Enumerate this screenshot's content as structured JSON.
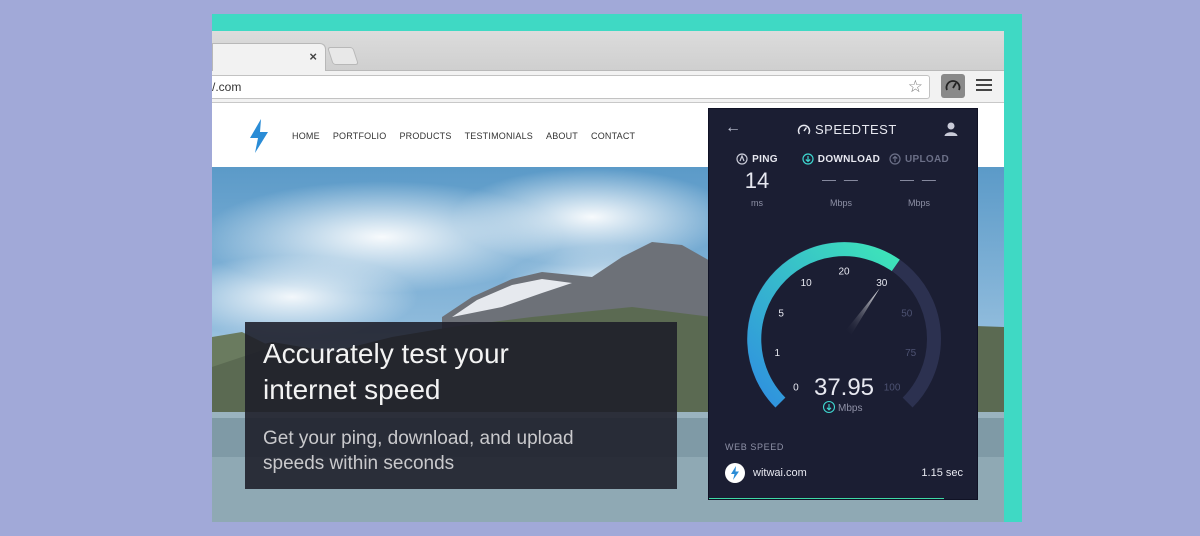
{
  "browser": {
    "tab_close": "×",
    "url_fragment": "/.com"
  },
  "site": {
    "nav": [
      "HOME",
      "PORTFOLIO",
      "PRODUCTS",
      "TESTIMONIALS",
      "ABOUT",
      "CONTACT"
    ],
    "hero_title_line1": "Accurately test your",
    "hero_title_line2": "internet speed",
    "hero_sub_line1": "Get your ping, download, and upload",
    "hero_sub_line2": "speeds within seconds"
  },
  "speedtest": {
    "back_icon": "←",
    "brand": "SPEEDTEST",
    "metrics": {
      "ping_label": "PING",
      "ping_value": "14",
      "ping_unit": "ms",
      "download_label": "DOWNLOAD",
      "download_value": "— —",
      "download_unit": "Mbps",
      "upload_label": "UPLOAD",
      "upload_value": "— —",
      "upload_unit": "Mbps"
    },
    "gauge": {
      "ticks": [
        "0",
        "1",
        "5",
        "10",
        "20",
        "30",
        "50",
        "75",
        "100"
      ],
      "reading": "37.95",
      "reading_unit": "Mbps",
      "reading_fraction": 0.63
    },
    "web_speed": {
      "label": "WEB SPEED",
      "host": "witwai.com",
      "time": "1.15 sec",
      "progress_fraction": 0.87
    },
    "colors": {
      "panel_bg": "#1b1e33",
      "accent_teal": "#3ed7d0",
      "accent_blue": "#2f8fe0",
      "frame_teal": "#3fd9c4"
    }
  }
}
